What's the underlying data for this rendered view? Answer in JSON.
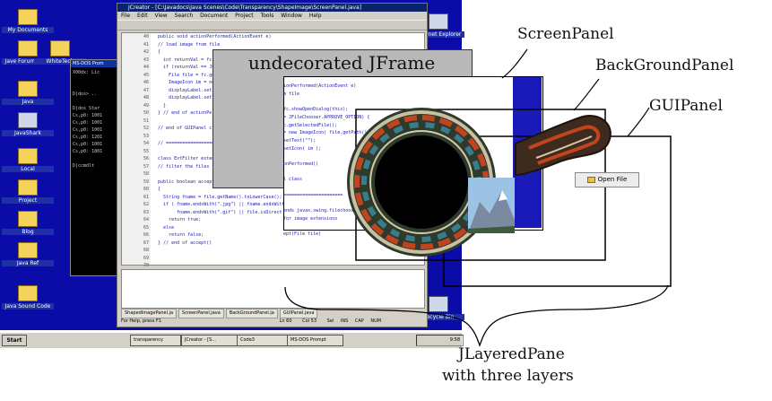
{
  "desktop": {
    "icons": [
      "My Documents",
      "Jave Forum Code",
      "WhiteTech",
      "Java",
      "JavaShark",
      "Local",
      "Project",
      "Blog",
      "Java Ref",
      "Java Sound Code",
      "Internet Explorer",
      "Recycle Bin"
    ]
  },
  "console": {
    "title": "MS-DOS Prom",
    "lines": [
      "X00dx: Lic",
      "",
      "",
      "D|dos> ..",
      "",
      "D|dos Star",
      "Cs,p0: 1001",
      "Cs,p0: 1001",
      "Cs,p0: 1001",
      "Cs,p0: 1201",
      "Cs,p0: 1001",
      "Cs,p0: 1801",
      "",
      "D|ccmdlt"
    ]
  },
  "editor": {
    "title": "JCreator - [C:\\Javadocs\\Java Scenes\\Code\\Transparency\\ShapeImage\\ScreenPanel.java]",
    "menu": "File  Edit  View  Search  Document  Project  Tools  Window  Help",
    "line_numbers": [
      "40",
      "41",
      "42",
      "43",
      "44",
      "45",
      "46",
      "47",
      "48",
      "49",
      "50",
      "51",
      "52",
      "53",
      "54",
      "55",
      "56",
      "57",
      "58",
      "59",
      "60",
      "61",
      "62",
      "63",
      "64",
      "65",
      "66",
      "67",
      "68",
      "69",
      "70"
    ],
    "code_lines": [
      "  public void actionPerformed(ActionEvent e)",
      "  // load image from file",
      "  {",
      "    int returnVal = fc.showOpenDialog(this);",
      "    if (returnVal == JFileChooser.APPROVE_OPTION) {",
      "      File file = fc.getSelectedFile();",
      "      ImageIcon im = new ImageIcon(file.getPath());",
      "      displayLabel.setIcon(im);",
      "      displayLabel.setText(\"\");",
      "    }",
      "  } // end of actionPerformed()",
      "",
      "  // end of GUIPanel class",
      "",
      "  // ==================================",
      "",
      "  class ExtFilter extends javax.swing.filechooser",
      "  // filter the files for image extensions",
      "",
      "  public boolean accept(File file)",
      "  {",
      "    String fname = file.getName().toLowerCase();",
      "    if ( fname.endsWith(\".jpg\") || fname.endsWith",
      "         fname.endsWith(\".gif\") || file.isDirect",
      "      return true;",
      "    else",
      "      return false;",
      "  } // end of accept()",
      "",
      "",
      ""
    ],
    "tabs": [
      "ShapedImagePanel.ja",
      "ScreenPanel.java",
      "BackGroundPanel.ja",
      "GUIPanel.java"
    ],
    "status": [
      "For Help, press F1",
      "Ln 60",
      "Col 53",
      "Sel",
      "INS",
      "CAP",
      "NUM"
    ]
  },
  "taskbar": {
    "start": "Start",
    "buttons": [
      "transparency",
      "JCreator - [S...",
      "Code3",
      "MS-DOS Prompt"
    ],
    "clock": "9:58"
  },
  "screen_panel_code": [
    "ionPerformed(ActionEvent e)",
    "m file",
    "",
    "fc.showOpenDialog(this);",
    "= JFileChooser.APPROVE_OPTION) {",
    "c.getSelectedFile();",
    "= new ImageIcon( file.getPath() );",
    "setText(\"\");",
    "setIcon( im );",
    "",
    "onPerformed()",
    "",
    "l class",
    "",
    "======================",
    "",
    "ends javax.swing.filechooser.",
    "for image extensions",
    "",
    "ept(File file)"
  ],
  "gui": {
    "open_button": "Open File"
  },
  "labels": {
    "undecorated": "undecorated JFrame",
    "screen_panel": "ScreenPanel",
    "background_panel": "BackGroundPanel",
    "gui_panel": "GUIPanel",
    "layered_1": "JLayeredPane",
    "layered_2": "with three layers"
  }
}
